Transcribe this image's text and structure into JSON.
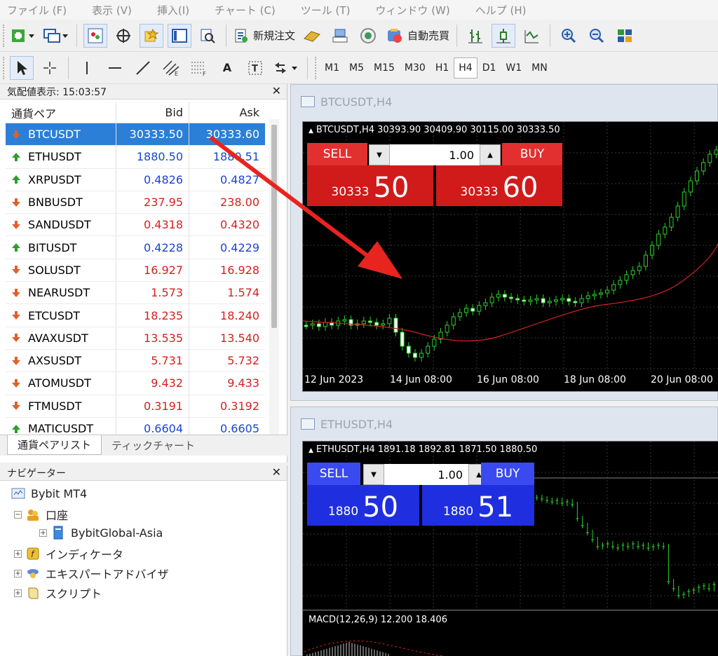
{
  "menu": [
    "ファイル (F)",
    "表示 (V)",
    "挿入(I)",
    "チャート (C)",
    "ツール (T)",
    "ウィンドウ (W)",
    "ヘルプ (H)"
  ],
  "toolbar": {
    "new_order": "新規注文",
    "auto_trading": "自動売買",
    "timeframes": [
      "M1",
      "M5",
      "M15",
      "M30",
      "H1",
      "H4",
      "D1",
      "W1",
      "MN"
    ],
    "active_timeframe": "H4",
    "text_tool": "A"
  },
  "market_watch": {
    "title": "気配値表示: 15:03:57",
    "col_symbol": "通貨ペア",
    "col_bid": "Bid",
    "col_ask": "Ask",
    "rows": [
      {
        "symbol": "BTCUSDT",
        "bid": "30333.50",
        "ask": "30333.60",
        "dir": "down",
        "selected": true
      },
      {
        "symbol": "ETHUSDT",
        "bid": "1880.50",
        "ask": "1880.51",
        "dir": "up"
      },
      {
        "symbol": "XRPUSDT",
        "bid": "0.4826",
        "ask": "0.4827",
        "dir": "up"
      },
      {
        "symbol": "BNBUSDT",
        "bid": "237.95",
        "ask": "238.00",
        "dir": "down"
      },
      {
        "symbol": "SANDUSDT",
        "bid": "0.4318",
        "ask": "0.4320",
        "dir": "down"
      },
      {
        "symbol": "BITUSDT",
        "bid": "0.4228",
        "ask": "0.4229",
        "dir": "up"
      },
      {
        "symbol": "SOLUSDT",
        "bid": "16.927",
        "ask": "16.928",
        "dir": "down"
      },
      {
        "symbol": "NEARUSDT",
        "bid": "1.573",
        "ask": "1.574",
        "dir": "down"
      },
      {
        "symbol": "ETCUSDT",
        "bid": "18.235",
        "ask": "18.240",
        "dir": "down"
      },
      {
        "symbol": "AVAXUSDT",
        "bid": "13.535",
        "ask": "13.540",
        "dir": "down"
      },
      {
        "symbol": "AXSUSDT",
        "bid": "5.731",
        "ask": "5.732",
        "dir": "down"
      },
      {
        "symbol": "ATOMUSDT",
        "bid": "9.432",
        "ask": "9.433",
        "dir": "down"
      },
      {
        "symbol": "FTMUSDT",
        "bid": "0.3191",
        "ask": "0.3192",
        "dir": "down"
      },
      {
        "symbol": "MATICUSDT",
        "bid": "0.6604",
        "ask": "0.6605",
        "dir": "up"
      }
    ],
    "tabs": [
      "通貨ペアリスト",
      "ティックチャート"
    ]
  },
  "navigator": {
    "title": "ナビゲーター",
    "root": "Bybit MT4",
    "accounts": "口座",
    "server": "BybitGlobal-Asia",
    "indicators": "インディケータ",
    "experts": "エキスパートアドバイザ",
    "scripts": "スクリプト"
  },
  "chart1": {
    "window_title": "BTCUSDT,H4",
    "info": "BTCUSDT,H4  30393.90 30409.90 30115.00 30333.50",
    "sell": "SELL",
    "buy": "BUY",
    "lot": "1.00",
    "bid_prefix": "30333",
    "bid_big": "50",
    "ask_prefix": "30333",
    "ask_big": "60",
    "dates": [
      "12 Jun 2023",
      "14 Jun 08:00",
      "16 Jun 08:00",
      "18 Jun 08:00",
      "20 Jun 08:00"
    ],
    "colors": {
      "sell": "#d11a1a",
      "buy": "#d11a1a"
    }
  },
  "chart2": {
    "window_title": "ETHUSDT,H4",
    "info": "ETHUSDT,H4  1891.18 1892.81 1871.50 1880.50",
    "sell": "SELL",
    "buy": "BUY",
    "lot": "1.00",
    "bid_prefix": "1880",
    "bid_big": "50",
    "ask_prefix": "1880",
    "ask_big": "51",
    "macd": "MACD(12,26,9) 12.200 18.406",
    "colors": {
      "sell": "#1f2fe0",
      "buy": "#1f2fe0"
    }
  }
}
